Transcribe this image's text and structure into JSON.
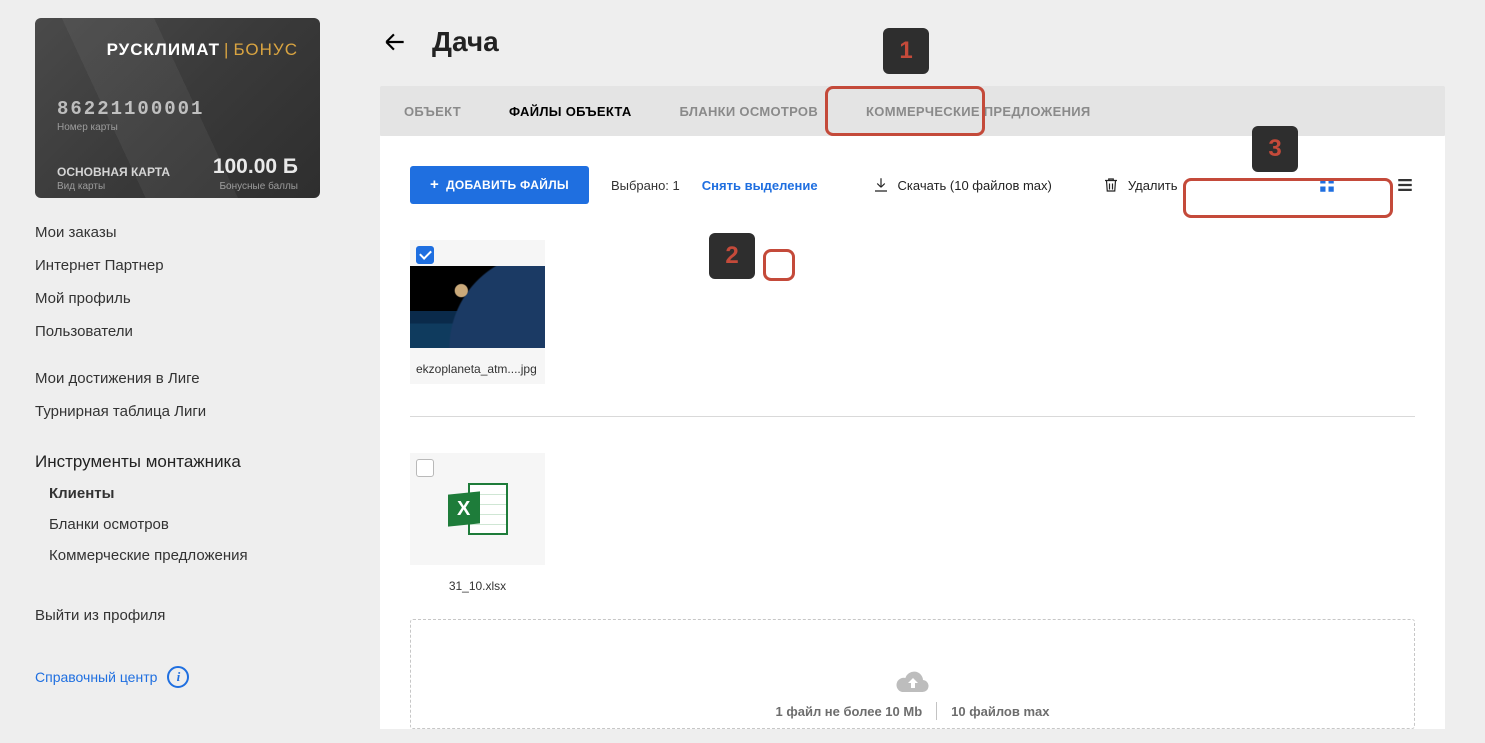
{
  "card": {
    "brand_main": "РУСКЛИМАТ",
    "brand_bonus": "БОНУС",
    "number": "86221100001",
    "number_label": "Номер карты",
    "type": "ОСНОВНАЯ КАРТА",
    "type_label": "Вид карты",
    "balance": "100.00 Б",
    "balance_label": "Бонусные баллы"
  },
  "nav": {
    "orders": "Мои заказы",
    "partner": "Интернет Партнер",
    "profile": "Мой профиль",
    "users": "Пользователи",
    "achievements": "Мои достижения в Лиге",
    "leaderboard": "Турнирная таблица Лиги",
    "tools_section": "Инструменты монтажника",
    "clients": "Клиенты",
    "blanks": "Бланки осмотров",
    "offers": "Коммерческие предложения",
    "logout": "Выйти из профиля",
    "help": "Справочный центр"
  },
  "page": {
    "title": "Дача"
  },
  "tabs": {
    "object": "ОБЪЕКТ",
    "files": "ФАЙЛЫ ОБЪЕКТА",
    "blanks": "БЛАНКИ ОСМОТРОВ",
    "offers": "КОММЕРЧЕСКИЕ ПРЕДЛОЖЕНИЯ"
  },
  "toolbar": {
    "add": "ДОБАВИТЬ ФАЙЛЫ",
    "selected_label": "Выбрано:",
    "selected_count": "1",
    "clear": "Снять выделение",
    "download": "Скачать (10 файлов max)",
    "delete": "Удалить"
  },
  "files": {
    "img_name": "ekzoplaneta_atm....jpg",
    "xls_name": "31_10.xlsx"
  },
  "dropzone": {
    "limit1": "1 файл не более 10 Mb",
    "limit2": "10 файлов max"
  },
  "markers": {
    "m1": "1",
    "m2": "2",
    "m3": "3"
  }
}
